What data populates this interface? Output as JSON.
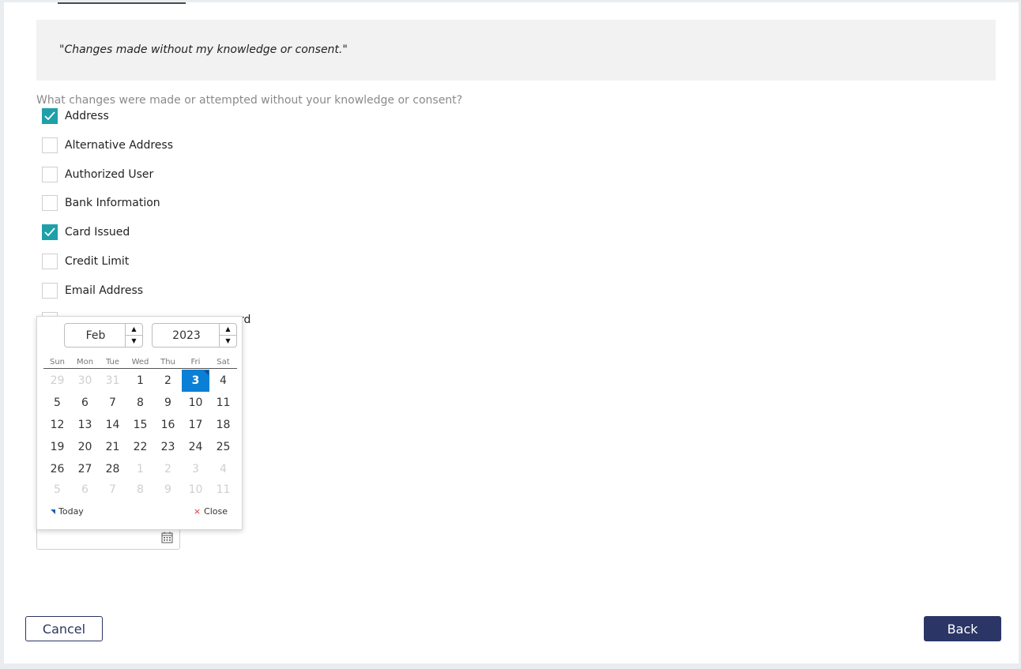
{
  "quote": "\"Changes made without my knowledge or consent.\"",
  "question": "What changes were made or attempted without your knowledge or consent?",
  "options": [
    {
      "label": "Address",
      "checked": true
    },
    {
      "label": "Alternative Address",
      "checked": false
    },
    {
      "label": "Authorized User",
      "checked": false
    },
    {
      "label": "Bank Information",
      "checked": false
    },
    {
      "label": "Card Issued",
      "checked": true
    },
    {
      "label": "Credit Limit",
      "checked": false
    },
    {
      "label": "Email Address",
      "checked": false
    }
  ],
  "hidden_option_tail": "rd",
  "datepicker": {
    "month": "Feb",
    "year": "2023",
    "weekdays": [
      "Sun",
      "Mon",
      "Tue",
      "Wed",
      "Thu",
      "Fri",
      "Sat"
    ],
    "weeks": [
      [
        "29",
        "30",
        "31",
        "1",
        "2",
        "3",
        "4"
      ],
      [
        "5",
        "6",
        "7",
        "8",
        "9",
        "10",
        "11"
      ],
      [
        "12",
        "13",
        "14",
        "15",
        "16",
        "17",
        "18"
      ],
      [
        "19",
        "20",
        "21",
        "22",
        "23",
        "24",
        "25"
      ],
      [
        "26",
        "27",
        "28",
        "1",
        "2",
        "3",
        "4"
      ],
      [
        "5",
        "6",
        "7",
        "8",
        "9",
        "10",
        "11"
      ]
    ],
    "other_month_flags": [
      [
        true,
        true,
        true,
        false,
        false,
        false,
        false
      ],
      [
        false,
        false,
        false,
        false,
        false,
        false,
        false
      ],
      [
        false,
        false,
        false,
        false,
        false,
        false,
        false
      ],
      [
        false,
        false,
        false,
        false,
        false,
        false,
        false
      ],
      [
        false,
        false,
        false,
        true,
        true,
        true,
        true
      ],
      [
        true,
        true,
        true,
        true,
        true,
        true,
        true
      ]
    ],
    "selected_day": "3",
    "today_label": "Today",
    "close_label": "Close"
  },
  "buttons": {
    "cancel": "Cancel",
    "back": "Back"
  },
  "colors": {
    "accent": "#1fa0a8",
    "selected_day": "#0a7fd6",
    "primary_button": "#2b3566"
  }
}
